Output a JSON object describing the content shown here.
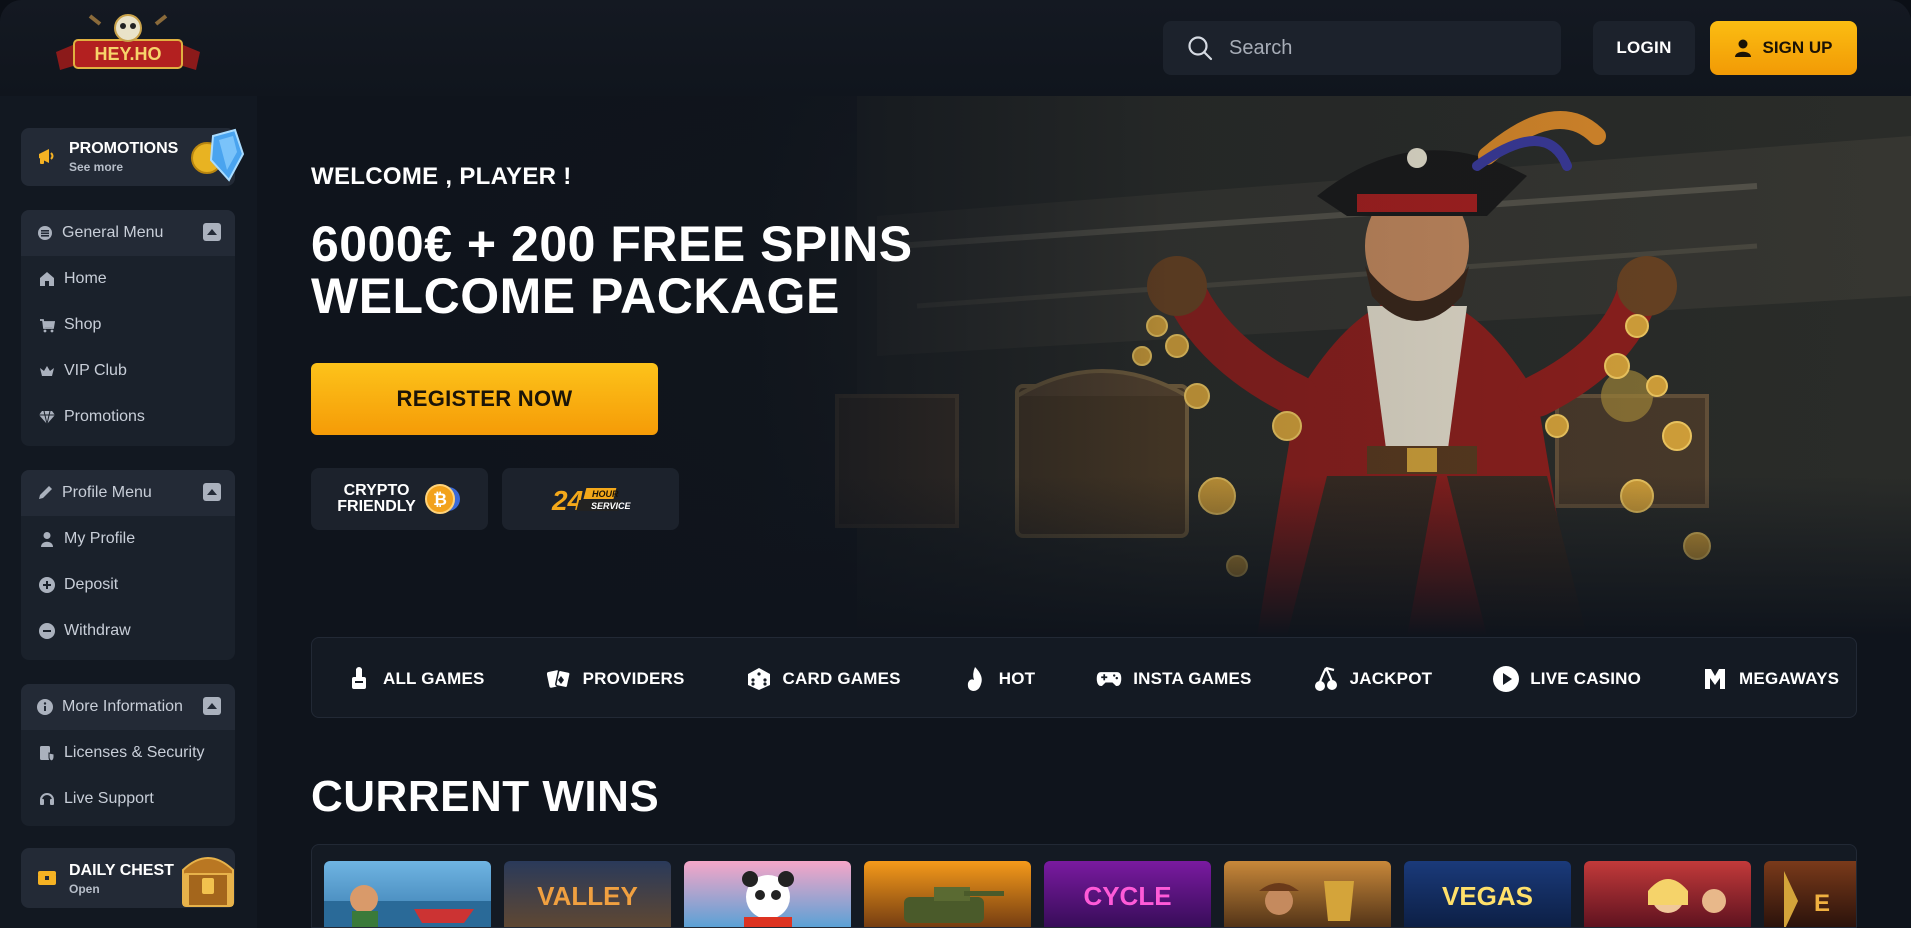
{
  "brand": {
    "logo_text": "HEY.HO"
  },
  "header": {
    "search_placeholder": "Search",
    "login_label": "LOGIN",
    "signup_label": "SIGN UP"
  },
  "sidebar": {
    "promo": {
      "title": "PROMOTIONS",
      "subtitle": "See more"
    },
    "groups": [
      {
        "label": "General Menu",
        "items": [
          {
            "label": "Home",
            "icon": "home-icon"
          },
          {
            "label": "Shop",
            "icon": "cart-icon"
          },
          {
            "label": "VIP Club",
            "icon": "crown-icon"
          },
          {
            "label": "Promotions",
            "icon": "diamond-icon"
          }
        ]
      },
      {
        "label": "Profile Menu",
        "items": [
          {
            "label": "My Profile",
            "icon": "user-icon"
          },
          {
            "label": "Deposit",
            "icon": "plus-circle-icon"
          },
          {
            "label": "Withdraw",
            "icon": "minus-circle-icon"
          }
        ]
      },
      {
        "label": "More Information",
        "items": [
          {
            "label": "Licenses & Security",
            "icon": "document-shield-icon"
          },
          {
            "label": "Live Support",
            "icon": "headset-icon"
          }
        ]
      }
    ],
    "chest": {
      "title": "DAILY CHEST",
      "subtitle": "Open"
    }
  },
  "hero": {
    "welcome": "WELCOME , PLAYER !",
    "headline_line1": "6000€ + 200 FREE SPINS",
    "headline_line2": "WELCOME PACKAGE",
    "cta": "REGISTER NOW",
    "badge_crypto_line1": "CRYPTO",
    "badge_crypto_line2": "FRIENDLY",
    "badge_service_num": "24",
    "badge_service_top": "HOUR",
    "badge_service_bottom": "SERVICE"
  },
  "categories": [
    {
      "label": "ALL GAMES",
      "icon": "all-games-icon"
    },
    {
      "label": "PROVIDERS",
      "icon": "providers-icon"
    },
    {
      "label": "CARD GAMES",
      "icon": "dice-icon"
    },
    {
      "label": "HOT",
      "icon": "flame-icon"
    },
    {
      "label": "INSTA GAMES",
      "icon": "gamepad-icon"
    },
    {
      "label": "JACKPOT",
      "icon": "cherries-icon"
    },
    {
      "label": "LIVE CASINO",
      "icon": "play-icon"
    },
    {
      "label": "MEGAWAYS",
      "icon": "megaways-icon"
    }
  ],
  "wins": {
    "title": "CURRENT WINS",
    "tiles": [
      {
        "label": "",
        "bg": "#4e8fbf"
      },
      {
        "label": "VALLEY",
        "bg": "#5b3a2a"
      },
      {
        "label": "",
        "bg": "#e25a8c"
      },
      {
        "label": "",
        "bg": "#b5521c"
      },
      {
        "label": "CYCLE",
        "bg": "#5a1a7a"
      },
      {
        "label": "",
        "bg": "#7a4a1c"
      },
      {
        "label": "VEGAS",
        "bg": "#1d3f7a"
      },
      {
        "label": "",
        "bg": "#8a2c2c"
      },
      {
        "label": "",
        "bg": "#3a1a12"
      }
    ]
  },
  "colors": {
    "accent": "#f7a90b",
    "panel": "#1c222c",
    "background": "#0f141c"
  }
}
